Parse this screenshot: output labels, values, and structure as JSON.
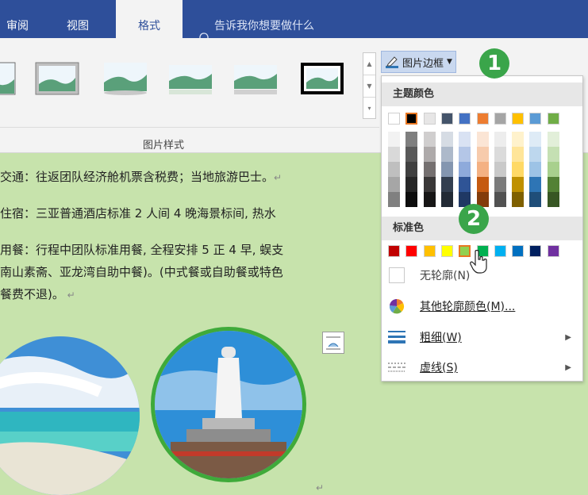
{
  "tabs": [
    {
      "label": "审阅",
      "active": false
    },
    {
      "label": "视图",
      "active": false
    },
    {
      "label": "格式",
      "active": true
    }
  ],
  "tell_me": "告诉我你想要做什么",
  "ribbon": {
    "group_label": "图片样式",
    "border_button": "图片边框"
  },
  "document": {
    "lines": [
      "交通：往返团队经济舱机票含税费；当地旅游巴士。",
      "住宿：三亚普通酒店标准 2 人间 4 晚海景标间, 热水",
      "用餐：行程中团队标准用餐, 全程安排 5 正 4 早, 蜈支",
      "南山素斋、亚龙湾自助中餐)。(中式餐或自助餐或特色",
      "餐费不退)。"
    ]
  },
  "menu": {
    "theme_header": "主题颜色",
    "standard_header": "标准色",
    "no_outline": "无轮廓(N)",
    "more_colors": "其他轮廓颜色(M)...",
    "weight": "粗细(W)",
    "dashes": "虚线(S)",
    "theme_colors": [
      "#ffffff",
      "#000000",
      "#e7e6e6",
      "#44546a",
      "#4472c4",
      "#ed7d31",
      "#a5a5a5",
      "#ffc000",
      "#5b9bd5",
      "#70ad47"
    ],
    "theme_shades": [
      [
        "#f2f2f2",
        "#d9d9d9",
        "#bfbfbf",
        "#a6a6a6",
        "#808080"
      ],
      [
        "#7f7f7f",
        "#595959",
        "#404040",
        "#262626",
        "#0d0d0d"
      ],
      [
        "#d0cece",
        "#aeaaaa",
        "#757070",
        "#3a3838",
        "#171616"
      ],
      [
        "#d6dce4",
        "#adb9ca",
        "#8496b0",
        "#333f50",
        "#222a35"
      ],
      [
        "#d9e2f3",
        "#b4c6e7",
        "#8eaadb",
        "#2f5496",
        "#1f3864"
      ],
      [
        "#fbe5d5",
        "#f7cbac",
        "#f4b183",
        "#c55a11",
        "#833c0b"
      ],
      [
        "#ededed",
        "#dbdbdb",
        "#c9c9c9",
        "#7b7b7b",
        "#525252"
      ],
      [
        "#fff2cc",
        "#ffe599",
        "#ffd966",
        "#bf9000",
        "#7f6000"
      ],
      [
        "#deebf6",
        "#bdd7ee",
        "#9dc3e6",
        "#2e75b5",
        "#1f4e79"
      ],
      [
        "#e2efd9",
        "#c5e0b3",
        "#a8d08d",
        "#538135",
        "#375623"
      ]
    ],
    "standard_colors": [
      "#c00000",
      "#ff0000",
      "#ffc000",
      "#ffff00",
      "#92d050",
      "#00b050",
      "#00b0f0",
      "#0070c0",
      "#002060",
      "#7030a0"
    ]
  },
  "badges": [
    "1",
    "2"
  ]
}
